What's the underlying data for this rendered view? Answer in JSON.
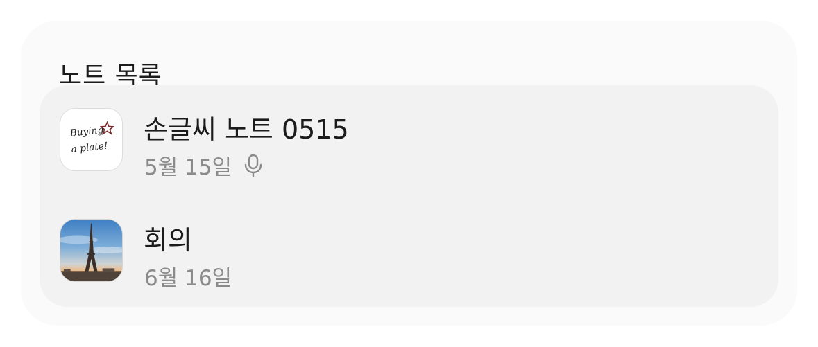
{
  "header": {
    "title": "노트 목록"
  },
  "notes": [
    {
      "title": "손글씨 노트 0515",
      "date": "5월 15일",
      "thumbnail_text_line1": "Buying",
      "thumbnail_text_line2": "a plate!",
      "thumbnail_type": "handwriting",
      "has_voice_recording": true,
      "meta_icon": "microphone-icon"
    },
    {
      "title": "회의",
      "date": "6월 16일",
      "thumbnail_type": "photo-eiffel-tower",
      "has_voice_recording": false
    }
  ],
  "colors": {
    "title_text": "#1b1b1b",
    "meta_text": "#8b8b8b",
    "panel_bg": "#fafafa",
    "card_bg": "#f2f2f2"
  }
}
